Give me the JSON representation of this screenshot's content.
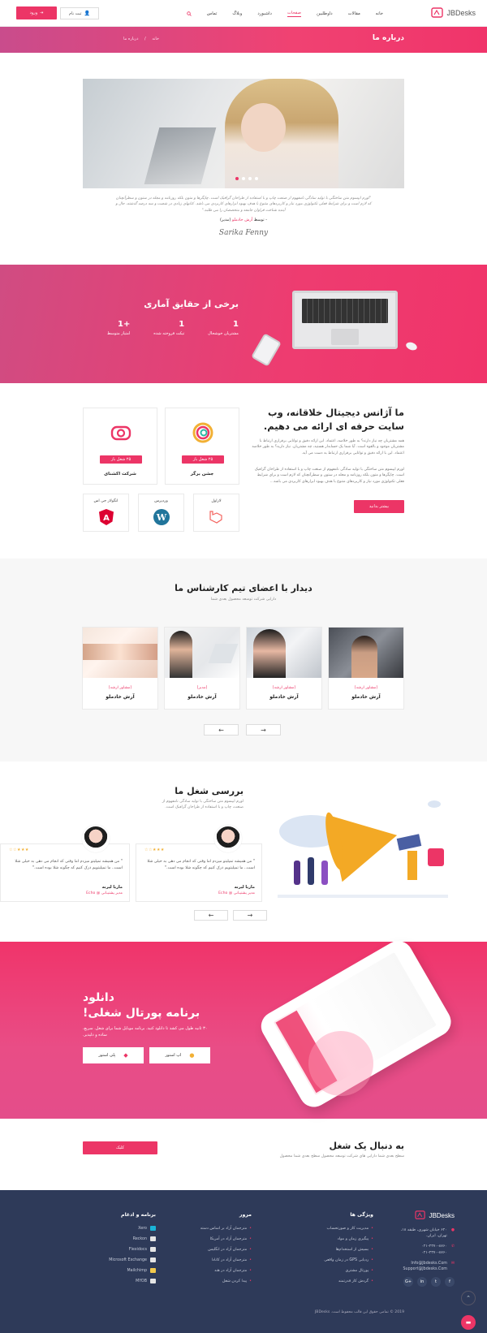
{
  "header": {
    "brand": "JBDesks",
    "nav": [
      "خانه",
      "مقالات",
      "داوطلبین",
      "صفحات",
      "داشبورد",
      "وبلاگ",
      "تماس"
    ],
    "active_nav": "صفحات",
    "register": "ثبت نام",
    "login": "ورود"
  },
  "page_header": {
    "title": "درباره ما",
    "crumb_home": "خانه",
    "crumb_current": "درباره ما"
  },
  "intro": {
    "quote": "\"لورم ایپسوم متن ساختگی با تولید سادگی نامفهوم از صنعت چاپ و با استفاده از طراحان گرافیک است. چاپگرها و متون بلکه روزنامه و مجله در ستون و سطرآنچنان که لازم است و برای شرایط فعلی تکنولوژی مورد نیاز و کاربردهای متنوع با هدف بهبود ابزارهای کاربردی می باشد. کتابهای زیادی در شصت و سه درصد گذشته، حال و آینده شناخت فراوان جامعه و متخصصان را می طلبد.\"",
    "author_prefix": "- توسط",
    "author_name": "آرش خادملو",
    "author_role": "(مدیر)",
    "signature": "Sarika Fenny"
  },
  "stats": {
    "title": "برخی از حقایق آماری",
    "items": [
      {
        "value": "1",
        "label": "مشتریان خوشحال"
      },
      {
        "value": "1",
        "label": "تیکت فروخته شده"
      },
      {
        "value": "+1",
        "label": "امتیاز متوسط"
      }
    ]
  },
  "agency": {
    "title_line1": "ما آژانس دیجیتال خلاقانه، وب",
    "title_line2": "سایت حرفه ای ارائه می دهیم.",
    "p1": "همه مشتریان چه نیاز دارند؟ به طور خلاصه، اعتماد. این ارائه دقیق و توانایی برقراری ارتباط با مشتریان موجود و بالقوه است. آیا شما یک حسابدار هستید، چه مشتریان. نیاز دارید؟ به طور خلاصه اعتماد. این با ارائه دقیق و توانایی برقراری ارتباط به دست می آید.",
    "p2": "لورم ایپسوم متن ساختگی با تولید سادگی نامفهوم از صنعت چاپ و با استفاده از طراحان گرافیک است. چاپگرها و متون بلکه روزنامه و مجله در ستون و سطرآنچنان که لازم است و برای شرایط فعلی تکنولوژی مورد نیاز و کاربردهای متنوع با هدف بهبود ابزارهای کاربردی می باشد...",
    "more": "بیشتر بدانید",
    "companies": [
      {
        "name": "جشن برگر",
        "badge": "۲۵ شغل باز"
      },
      {
        "name": "شرکت اکشنای",
        "badge": "۲۵ شغل باز"
      }
    ],
    "tech": [
      "لاراول",
      "وردپرس",
      "انگولار جی اس"
    ]
  },
  "team": {
    "title": "دیدار با اعضای تیم کارشناس ما",
    "subtitle": "دارایی شرکت توسعه محصول بعدی شما",
    "members": [
      {
        "role": "(مشاور ارشد)",
        "name": "آرش خادملو"
      },
      {
        "role": "(مشاور ارشد)",
        "name": "آرش خادملو"
      },
      {
        "role": "(مدیر)",
        "name": "آرش خادملو"
      },
      {
        "role": "(مشاور ارشد)",
        "name": "آرش خادملو"
      }
    ]
  },
  "reviews": {
    "title": "بررسی شغل ما",
    "subtitle": "لورم ایپسوم متن ساختگی با تولید سادگی نامفهوم از صنعت، چاپ و با استفاده از طراحان گرافیک است.",
    "items": [
      {
        "text": "\" من همیشه تمپلیتو میزدم اما وقتی که انجام می دهی به خیلی شلا است.. ما تمپلیتویم ذرک کنیم که چگونه شلا بوده است.\"",
        "name": "ماریا لیرنه",
        "role": "مدیر پشتیبانی @ Echo"
      },
      {
        "text": "\" من همیشه تمپلیتو میزدم اما وقتی که انجام می دهی به خیلی شلا است.. ما تمپلیتویم ذرک کنیم که چگونه شلا بوده است.\"",
        "name": "ماریا لیرنه",
        "role": "مدیر پشتیبانی @ Echo"
      }
    ]
  },
  "app": {
    "title_line1": "دانلود",
    "title_line2": "برنامه پورتال شغلی!",
    "desc": "۳۰ ثانیه طول می کشد تا دانلود کنید. برنامه موبایل شما برای شغل. سریع، ساده و دلپذیر.",
    "appstore": "اپ استور",
    "playstore": "پلی استور"
  },
  "jobsearch": {
    "title": "به دنبال یک شغل",
    "subtitle": "سطح بعدی شما دارایی های شرکت توسعه محصول سطح بعدی شما محصول",
    "button": "کلیک"
  },
  "footer": {
    "brand": "JBDesks",
    "address": "۶۲۰ خیابان شهری، طبقه ۱۸، تهران، ایران.",
    "phones": [
      "۰۲۱-۲۳۷۰-۸۷۶۰",
      "۰۲۱-۲۳۷۰-۸۷۶۰"
    ],
    "emails": [
      "Info@Jbdesks.Com",
      "Support@Jbdesks.Com"
    ],
    "features_title": "ویژگی ها",
    "features": [
      "مدیریت کار و صورتحساب",
      "پیگیری زمان و مواد",
      "بسیش از استخدام‌ها",
      "ردیابی GPS در زمان واقعی",
      "پورتال مشتری",
      "گردش کار قدرتمند"
    ],
    "browse_title": "مرور",
    "browse": [
      "مترجمان آزاد بر اساس دسته",
      "مترجمان آزاد در آمریکا",
      "مترجمان آزاد در انگلیس",
      "مترجمان آزاد در کانادا",
      "مترجمان آزاد در هند",
      "پیدا کردن شغل"
    ],
    "apps_title": "برنامه و ادغام",
    "apps": [
      "Xero",
      "Reckon",
      "Flexidocs",
      "Microsoft Exchange",
      "Mailchimp",
      "MYOB"
    ],
    "copyright": "2019 © تمامی حقوق این قالب محفوظ است. JBDesks"
  },
  "colors": {
    "accent": "#ec3566",
    "footer": "#2e3a59"
  }
}
